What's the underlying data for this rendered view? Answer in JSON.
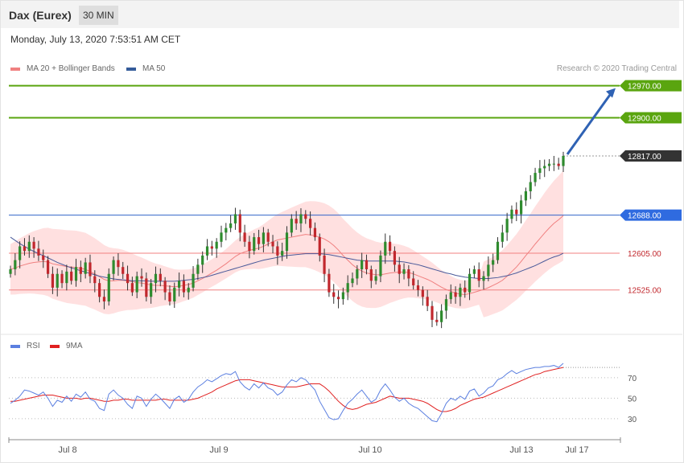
{
  "header": {
    "title": "Dax (Eurex)",
    "timeframe": "30 MIN",
    "timestamp": "Monday, July 13, 2020 7:53:51 AM CET"
  },
  "legend": {
    "ma20": "MA 20 + Bollinger Bands",
    "ma50": "MA 50",
    "copyright": "Research © 2020 Trading Central"
  },
  "rsi_legend": {
    "rsi": "RSI",
    "ma9": "9MA"
  },
  "colors": {
    "bull": "#2e8b2e",
    "bear": "#c1272d",
    "target": "#5aa50f",
    "pivot": "#3364c9",
    "support": "#f08080",
    "last": "#333333",
    "ma50": "#4a5a9a",
    "bb_fill": "#ffd6d6",
    "rsi": "#5b7fe0",
    "rsi_ma": "#e02020",
    "arrow": "#2f62b4"
  },
  "chart_data": [
    {
      "type": "candlestick",
      "ylim": [
        12430,
        12985
      ],
      "x_tick_labels": [
        "Jul 8",
        "Jul 9",
        "Jul 10",
        "Jul 13",
        "Jul 17"
      ],
      "levels": [
        {
          "value": 12970.0,
          "label": "12970.00",
          "kind": "target"
        },
        {
          "value": 12900.0,
          "label": "12900.00",
          "kind": "target"
        },
        {
          "value": 12817.0,
          "label": "12817.00",
          "kind": "last"
        },
        {
          "value": 12688.0,
          "label": "12688.00",
          "kind": "pivot"
        },
        {
          "value": 12605.0,
          "label": "12605.00",
          "kind": "support"
        },
        {
          "value": 12525.0,
          "label": "12525.00",
          "kind": "support"
        }
      ],
      "close_prices": [
        12570,
        12590,
        12620,
        12610,
        12630,
        12615,
        12600,
        12590,
        12560,
        12530,
        12560,
        12540,
        12565,
        12545,
        12575,
        12560,
        12585,
        12555,
        12540,
        12510,
        12500,
        12560,
        12590,
        12575,
        12560,
        12540,
        12520,
        12555,
        12550,
        12510,
        12540,
        12560,
        12545,
        12520,
        12500,
        12530,
        12545,
        12520,
        12530,
        12560,
        12580,
        12600,
        12620,
        12615,
        12630,
        12650,
        12660,
        12670,
        12690,
        12650,
        12630,
        12610,
        12640,
        12625,
        12650,
        12630,
        12620,
        12600,
        12610,
        12650,
        12680,
        12670,
        12690,
        12680,
        12660,
        12640,
        12600,
        12560,
        12520,
        12510,
        12505,
        12520,
        12540,
        12550,
        12570,
        12590,
        12570,
        12545,
        12555,
        12600,
        12630,
        12610,
        12580,
        12560,
        12570,
        12550,
        12535,
        12525,
        12510,
        12490,
        12460,
        12455,
        12480,
        12505,
        12520,
        12510,
        12530,
        12520,
        12560,
        12570,
        12545,
        12555,
        12580,
        12590,
        12630,
        12650,
        12680,
        12700,
        12690,
        12720,
        12740,
        12760,
        12780,
        12790,
        12795,
        12800,
        12800,
        12795,
        12817
      ],
      "ma20": [
        12570,
        12573,
        12577,
        12580,
        12583,
        12585,
        12586,
        12587,
        12586,
        12582,
        12580,
        12578,
        12576,
        12575,
        12574,
        12572,
        12570,
        12565,
        12560,
        12554,
        12548,
        12545,
        12545,
        12546,
        12546,
        12545,
        12543,
        12541,
        12540,
        12538,
        12536,
        12535,
        12535,
        12534,
        12533,
        12532,
        12533,
        12535,
        12537,
        12540,
        12545,
        12550,
        12556,
        12562,
        12568,
        12575,
        12582,
        12590,
        12598,
        12604,
        12608,
        12611,
        12614,
        12616,
        12620,
        12625,
        12630,
        12634,
        12636,
        12638,
        12640,
        12642,
        12644,
        12646,
        12645,
        12643,
        12640,
        12636,
        12630,
        12622,
        12612,
        12600,
        12590,
        12580,
        12572,
        12566,
        12562,
        12560,
        12558,
        12558,
        12560,
        12562,
        12563,
        12564,
        12564,
        12563,
        12560,
        12556,
        12552,
        12548,
        12543,
        12537,
        12531,
        12526,
        12522,
        12518,
        12516,
        12515,
        12517,
        12520,
        12523,
        12526,
        12530,
        12535,
        12540,
        12546,
        12555,
        12565,
        12575,
        12587,
        12600,
        12612,
        12625,
        12637,
        12649,
        12660,
        12670,
        12678,
        12687
      ],
      "ma50": [
        12640,
        12633,
        12626,
        12620,
        12614,
        12609,
        12604,
        12600,
        12595,
        12590,
        12585,
        12581,
        12577,
        12573,
        12570,
        12567,
        12564,
        12561,
        12558,
        12555,
        12553,
        12551,
        12549,
        12548,
        12547,
        12546,
        12545,
        12545,
        12545,
        12545,
        12544,
        12544,
        12544,
        12544,
        12544,
        12544,
        12545,
        12546,
        12547,
        12548,
        12550,
        12552,
        12554,
        12557,
        12560,
        12563,
        12566,
        12569,
        12572,
        12575,
        12578,
        12581,
        12584,
        12587,
        12590,
        12592,
        12594,
        12596,
        12598,
        12600,
        12601,
        12602,
        12603,
        12604,
        12604,
        12604,
        12604,
        12603,
        12602,
        12600,
        12598,
        12596,
        12594,
        12592,
        12590,
        12589,
        12588,
        12588,
        12588,
        12588,
        12588,
        12588,
        12588,
        12587,
        12586,
        12584,
        12582,
        12580,
        12577,
        12574,
        12571,
        12568,
        12565,
        12562,
        12560,
        12557,
        12555,
        12553,
        12552,
        12551,
        12550,
        12550,
        12550,
        12551,
        12552,
        12554,
        12556,
        12559,
        12562,
        12566,
        12570,
        12574,
        12578,
        12583,
        12588,
        12593,
        12597,
        12600,
        12605
      ]
    },
    {
      "type": "line",
      "ylim": [
        15,
        95
      ],
      "y_ticks": [
        30,
        50,
        70
      ],
      "reference_line": 80,
      "series": [
        {
          "name": "RSI",
          "values": [
            45,
            48,
            52,
            58,
            57,
            55,
            53,
            56,
            50,
            42,
            48,
            46,
            52,
            47,
            54,
            51,
            56,
            49,
            47,
            40,
            38,
            54,
            58,
            53,
            50,
            44,
            40,
            52,
            50,
            42,
            49,
            54,
            50,
            45,
            40,
            49,
            52,
            46,
            49,
            56,
            61,
            64,
            68,
            66,
            69,
            72,
            74,
            73,
            76,
            66,
            61,
            58,
            64,
            60,
            65,
            60,
            58,
            53,
            56,
            63,
            68,
            66,
            70,
            68,
            63,
            58,
            47,
            39,
            31,
            29,
            30,
            38,
            45,
            49,
            54,
            58,
            52,
            46,
            49,
            58,
            64,
            58,
            51,
            47,
            50,
            45,
            42,
            40,
            36,
            32,
            28,
            27,
            35,
            45,
            50,
            48,
            52,
            49,
            57,
            59,
            52,
            55,
            60,
            62,
            68,
            70,
            74,
            77,
            74,
            76,
            78,
            79,
            80,
            80,
            81,
            81,
            82,
            80,
            84
          ]
        },
        {
          "name": "9MA",
          "values": [
            47,
            47,
            48,
            49,
            50,
            51,
            52,
            53,
            53,
            53,
            52,
            51,
            50,
            50,
            50,
            49,
            50,
            50,
            49,
            48,
            47,
            47,
            48,
            48,
            49,
            49,
            48,
            48,
            48,
            48,
            48,
            48,
            49,
            49,
            48,
            48,
            48,
            48,
            48,
            49,
            50,
            52,
            54,
            56,
            59,
            61,
            63,
            65,
            67,
            68,
            68,
            68,
            67,
            66,
            65,
            64,
            63,
            62,
            61,
            61,
            61,
            61,
            62,
            63,
            64,
            64,
            64,
            61,
            57,
            52,
            47,
            43,
            40,
            39,
            40,
            42,
            44,
            45,
            46,
            48,
            50,
            52,
            51,
            50,
            50,
            50,
            49,
            48,
            47,
            45,
            42,
            39,
            37,
            37,
            38,
            40,
            43,
            45,
            47,
            49,
            50,
            51,
            53,
            55,
            57,
            59,
            61,
            63,
            65,
            67,
            69,
            71,
            73,
            74,
            76,
            77,
            78,
            79,
            80
          ]
        }
      ]
    }
  ]
}
